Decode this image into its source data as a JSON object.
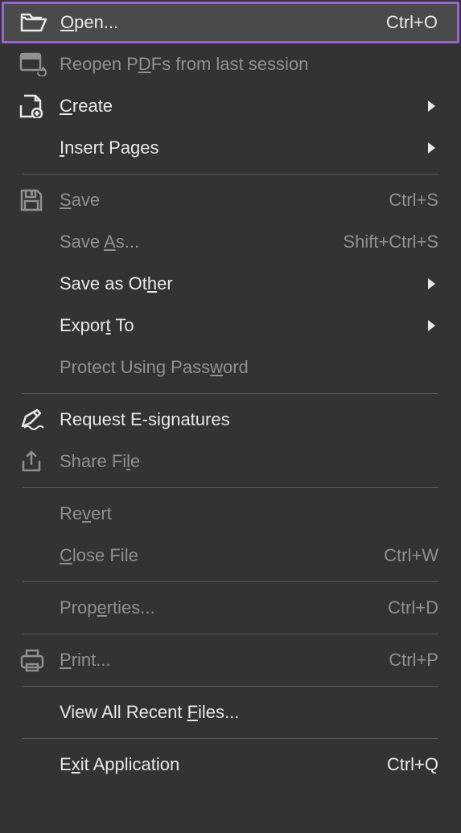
{
  "menu": {
    "items": [
      {
        "label_pre": "",
        "mnemonic": "O",
        "label_post": "pen...",
        "shortcut": "Ctrl+O",
        "icon": "open-folder",
        "state": "highlighted",
        "submenu": false
      },
      {
        "label_pre": "Reopen P",
        "mnemonic": "D",
        "label_post": "Fs from last session",
        "shortcut": "",
        "icon": "reopen",
        "state": "disabled",
        "submenu": false
      },
      {
        "label_pre": "",
        "mnemonic": "C",
        "label_post": "reate",
        "shortcut": "",
        "icon": "create",
        "state": "enabled",
        "submenu": true
      },
      {
        "label_pre": "",
        "mnemonic": "I",
        "label_post": "nsert Pages",
        "shortcut": "",
        "icon": "",
        "state": "enabled",
        "submenu": true
      },
      {
        "separator": true
      },
      {
        "label_pre": "",
        "mnemonic": "S",
        "label_post": "ave",
        "shortcut": "Ctrl+S",
        "icon": "save",
        "state": "disabled",
        "submenu": false
      },
      {
        "label_pre": "Save ",
        "mnemonic": "A",
        "label_post": "s...",
        "shortcut": "Shift+Ctrl+S",
        "icon": "",
        "state": "disabled",
        "submenu": false
      },
      {
        "label_pre": "Save as Ot",
        "mnemonic": "h",
        "label_post": "er",
        "shortcut": "",
        "icon": "",
        "state": "enabled",
        "submenu": true
      },
      {
        "label_pre": "Expor",
        "mnemonic": "t",
        "label_post": " To",
        "shortcut": "",
        "icon": "",
        "state": "enabled",
        "submenu": true
      },
      {
        "label_pre": "Protect Using Pass",
        "mnemonic": "w",
        "label_post": "ord",
        "shortcut": "",
        "icon": "",
        "state": "disabled",
        "submenu": false
      },
      {
        "separator": true
      },
      {
        "label_pre": "Request E-si",
        "mnemonic": "g",
        "label_post": "natures",
        "shortcut": "",
        "icon": "signature",
        "state": "enabled",
        "submenu": false
      },
      {
        "label_pre": "Share Fi",
        "mnemonic": "l",
        "label_post": "e",
        "shortcut": "",
        "icon": "share",
        "state": "disabled",
        "submenu": false
      },
      {
        "separator": true
      },
      {
        "label_pre": "Re",
        "mnemonic": "v",
        "label_post": "ert",
        "shortcut": "",
        "icon": "",
        "state": "disabled",
        "submenu": false
      },
      {
        "label_pre": "",
        "mnemonic": "C",
        "label_post": "lose File",
        "shortcut": "Ctrl+W",
        "icon": "",
        "state": "disabled",
        "submenu": false
      },
      {
        "separator": true
      },
      {
        "label_pre": "Prop",
        "mnemonic": "e",
        "label_post": "rties...",
        "shortcut": "Ctrl+D",
        "icon": "",
        "state": "disabled",
        "submenu": false
      },
      {
        "separator": true
      },
      {
        "label_pre": "",
        "mnemonic": "P",
        "label_post": "rint...",
        "shortcut": "Ctrl+P",
        "icon": "print",
        "state": "disabled",
        "submenu": false
      },
      {
        "separator": true
      },
      {
        "label_pre": "View All Recent ",
        "mnemonic": "F",
        "label_post": "iles...",
        "shortcut": "",
        "icon": "",
        "state": "enabled",
        "submenu": false
      },
      {
        "separator": true
      },
      {
        "label_pre": "E",
        "mnemonic": "x",
        "label_post": "it Application",
        "shortcut": "Ctrl+Q",
        "icon": "",
        "state": "enabled",
        "submenu": false
      }
    ]
  }
}
